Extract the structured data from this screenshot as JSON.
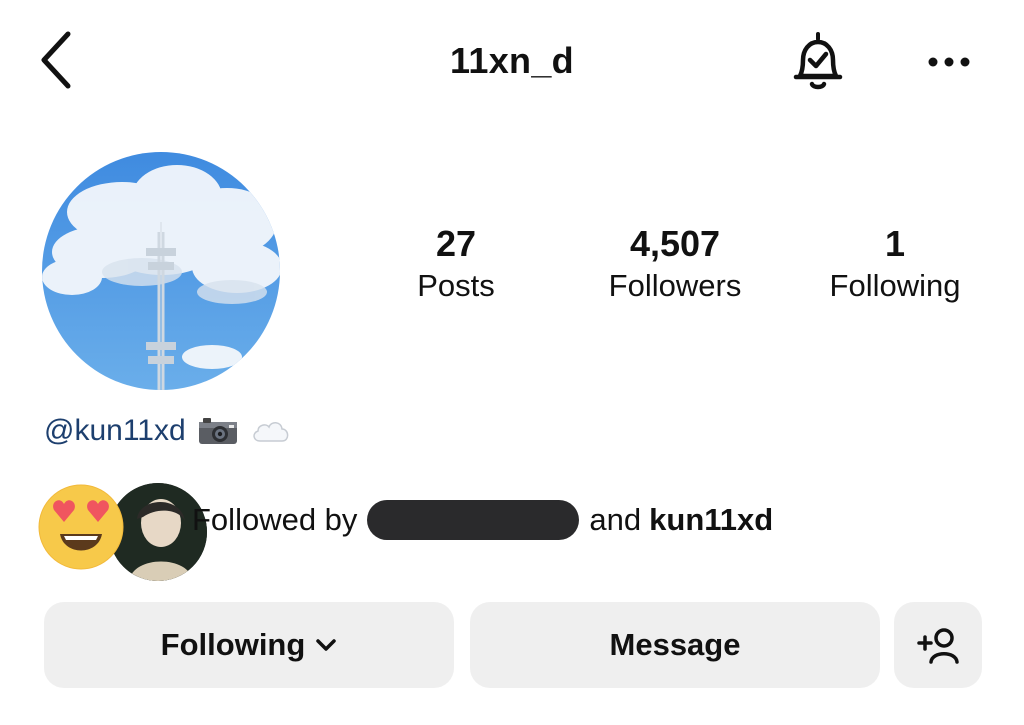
{
  "header": {
    "username": "11xn_d",
    "icons": {
      "back": "chevron-left-icon",
      "notifications": "bell-check-icon",
      "more": "more-horizontal-icon"
    }
  },
  "profile": {
    "avatar": "cloud-sky-tower-avatar"
  },
  "stats": {
    "posts": {
      "value": "27",
      "label": "Posts"
    },
    "followers": {
      "value": "4,507",
      "label": "Followers"
    },
    "following": {
      "value": "1",
      "label": "Following"
    }
  },
  "bio": {
    "mention": "@kun11xd",
    "emojis": [
      "camera-emoji",
      "cloud-emoji"
    ]
  },
  "followed_by": {
    "prefix": "Followed by",
    "connector": "and",
    "named_user": "kun11xd"
  },
  "actions": {
    "following_label": "Following",
    "message_label": "Message",
    "add_user_icon": "add-user-icon"
  },
  "colors": {
    "bio_link": "#1d3f6e",
    "button_bg": "#efefef"
  }
}
